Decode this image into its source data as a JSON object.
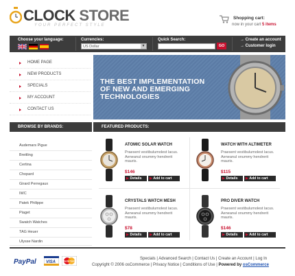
{
  "header": {
    "logo_main": "CLOCK",
    "logo_store": "STORE",
    "tagline": "YOUR PERFECT STYLE",
    "cart_title": "Shopping cart:",
    "cart_prefix": "now in your cart",
    "cart_count": "5 items"
  },
  "toolbar": {
    "language_label": "Choose your language:",
    "currency_label": "Currencies:",
    "currency_value": "US Dollar",
    "search_label": "Quick Search:",
    "search_placeholder": "",
    "go_label": "GO",
    "create_account": "Create an account",
    "customer_login": "Customer login",
    "flags": [
      "english",
      "german",
      "spanish"
    ]
  },
  "nav": {
    "items": [
      "HOME PAGE",
      "NEW PRODUCTS",
      "SPECIALS",
      "MY ACCOUNT",
      "CONTACT US"
    ]
  },
  "banner": {
    "line1": "THE BEST IMPLEMENTATION",
    "line2": "OF NEW AND EMERGING",
    "line3": "TECHNOLOGIES"
  },
  "brands": {
    "heading": "BROWSE BY BRANDS:",
    "items": [
      "Audemars Pigue",
      "Breitling",
      "Certina",
      "Chopard",
      "Girard Perregaux",
      "IWC",
      "Patek Philippe",
      "Piaget",
      "Swatch Watches",
      "TAG Heuer",
      "Ulysse Nardin"
    ]
  },
  "products": {
    "heading": "FEATURED PRODUCTS:",
    "details_label": "Details",
    "cart_label": "Add to cart",
    "items": [
      {
        "name": "ATOMIC SOLAR WATCH",
        "desc": "Praesent vestibulumolest lacus. Aeneanul onummy hendrerit mauris.",
        "price": "$146"
      },
      {
        "name": "WATCH WITH ALTIMETER",
        "desc": "Praesent vestibulumolest lacus. Aeneanul onummy hendrerit mauris.",
        "price": "$115"
      },
      {
        "name": "CRYSTALS WATCH MESH",
        "desc": "Praesent vestibulumolest lacus. Aeneanul onummy hendrerit mauris.",
        "price": "$78"
      },
      {
        "name": "PRO DIVER WATCH",
        "desc": "Praesent vestibulumolest lacus. Aeneanul onummy hendrerit mauris.",
        "price": "$146"
      }
    ]
  },
  "footer": {
    "links": [
      "Specials",
      "Advanced Search",
      "Contact Us",
      "Create an Account",
      "Log In"
    ],
    "copyright": "Copyright © 2006 osCommerce",
    "privacy": "Privacy Notice",
    "conditions": "Conditions of Use",
    "powered_prefix": "Powered by",
    "powered_link": "osCommerce",
    "paypal": "PayPal",
    "visa": "VISA",
    "mastercard": "MasterCard"
  },
  "colors": {
    "accent": "#c8102e",
    "dark_bar": "#3c3c3c",
    "banner": "#5b7ba5"
  }
}
